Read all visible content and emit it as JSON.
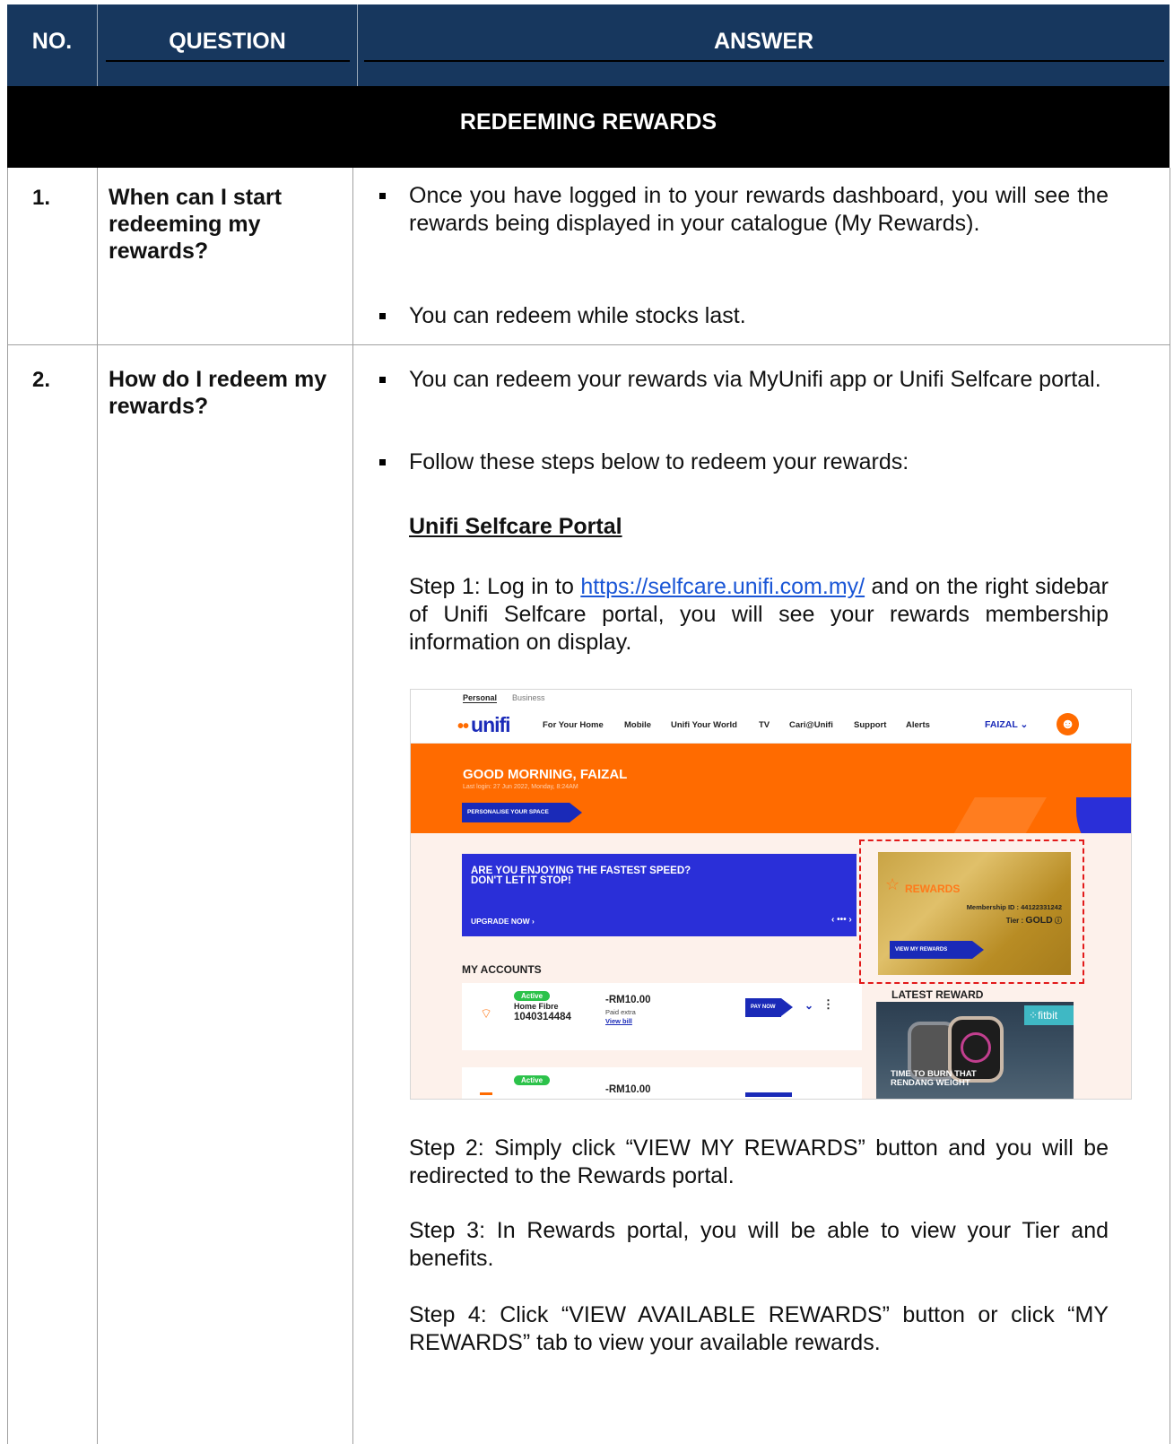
{
  "header": {
    "col_no": "NO.",
    "col_question": "QUESTION",
    "col_answer": "ANSWER"
  },
  "section": {
    "title": "REDEEMING REWARDS"
  },
  "rows": [
    {
      "no": "1.",
      "question": "When can I start redeeming my rewards?",
      "answers": [
        "Once you have logged in to your rewards dashboard, you will see the rewards being displayed in your catalogue (My Rewards).",
        "You can redeem while stocks last."
      ]
    },
    {
      "no": "2.",
      "question": "How do I redeem my rewards?",
      "answers": [
        "You can redeem your rewards via MyUnifi app or Unifi Selfcare portal.",
        "Follow these steps below to redeem your rewards:"
      ],
      "subheading": "Unifi Selfcare Portal",
      "step1_prefix": "Step 1: Log in to ",
      "step1_link": "https://selfcare.unifi.com.my/",
      "step1_suffix": " and on the right sidebar of Unifi Selfcare portal, you will see your rewards membership information on display.",
      "step2": "Step 2: Simply click “VIEW MY REWARDS” button and you will be redirected to the Rewards portal.",
      "step3": "Step 3: In Rewards portal, you will be able to view your Tier and benefits.",
      "step4": "Step 4: Click “VIEW AVAILABLE REWARDS” button or click “MY REWARDS” tab to view your available rewards."
    }
  ],
  "screenshot": {
    "topbar": [
      "Personal",
      "Business"
    ],
    "logo": "unifi",
    "nav": [
      "For Your Home",
      "Mobile",
      "Unifi Your World",
      "TV",
      "Cari@Unifi",
      "Support",
      "Alerts"
    ],
    "user": "FAIZAL",
    "greeting": "GOOD MORNING, FAIZAL",
    "last_login": "Last login: 27 Jun 2022, Monday, 8:24AM",
    "personalise_btn": "PERSONALISE YOUR SPACE",
    "promo_line1": "ARE YOU ENJOYING THE FASTEST SPEED?",
    "promo_line2": "DON'T LET IT STOP!",
    "upgrade": "UPGRADE NOW",
    "my_accounts": "MY ACCOUNTS",
    "accounts": [
      {
        "status": "Active",
        "type": "Home Fibre",
        "number": "1040314484",
        "amount": "-RM10.00",
        "sub": "Paid extra",
        "view": "View bill",
        "pay": "PAY NOW"
      },
      {
        "status": "Active",
        "amount": "-RM10.00"
      }
    ],
    "rewards_title": "REWARDS",
    "membership": "Membership ID : 44122331242",
    "tier_label": "Tier :",
    "tier": "GOLD",
    "view_rewards_btn": "VIEW MY REWARDS",
    "latest_reward": "LATEST REWARD",
    "fitbit": "fitbit",
    "fitbit_text_1": "TIME TO BURN THAT",
    "fitbit_text_2": "RENDANG WEIGHT",
    "accent_blue": "#1a2ab8",
    "accent_orange": "#ff6b00"
  }
}
